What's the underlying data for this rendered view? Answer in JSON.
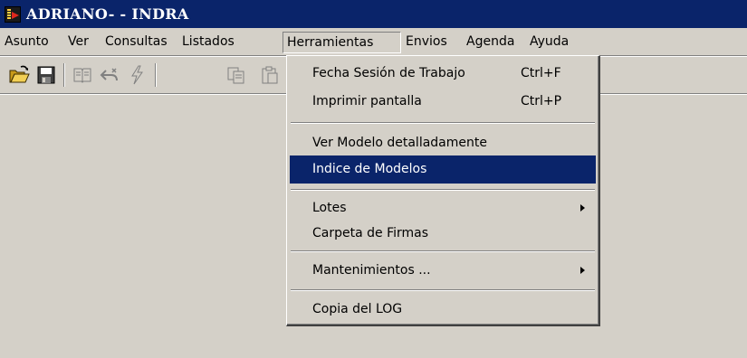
{
  "window": {
    "title": "ADRIANO- - INDRA",
    "app_icon": "app-logo-icon"
  },
  "menubar": {
    "items": [
      {
        "label": "Asunto"
      },
      {
        "label": "Ver"
      },
      {
        "label": "Consultas"
      },
      {
        "label": "Listados"
      },
      {
        "label": "Herramientas",
        "open": true
      },
      {
        "label": "Envios"
      },
      {
        "label": "Agenda"
      },
      {
        "label": "Ayuda"
      }
    ]
  },
  "toolbar": {
    "buttons": [
      {
        "icon": "open-folder-icon",
        "enabled": true
      },
      {
        "icon": "save-icon",
        "enabled": true
      },
      {
        "icon": "book-icon",
        "enabled": false
      },
      {
        "icon": "undo-icon",
        "enabled": false
      },
      {
        "icon": "lightning-icon",
        "enabled": false
      },
      {
        "icon": "copy-icon",
        "enabled": false
      },
      {
        "icon": "paste-icon",
        "enabled": false
      }
    ]
  },
  "dropdown": {
    "menu": "Herramientas",
    "items": [
      {
        "label": "Fecha Sesión de Trabajo",
        "shortcut": "Ctrl+F"
      },
      {
        "label": "Imprimir pantalla",
        "shortcut": "Ctrl+P"
      },
      {
        "label": "Ver Modelo detalladamente"
      },
      {
        "label": "Indice de Modelos",
        "selected": true
      },
      {
        "label": "Lotes",
        "submenu": true
      },
      {
        "label": "Carpeta de Firmas"
      },
      {
        "label": "Mantenimientos ...",
        "submenu": true
      },
      {
        "label": "Copia del LOG"
      }
    ]
  },
  "colors": {
    "titlebar_bg": "#0a246a",
    "face": "#d4d0c8",
    "selection": "#0a246a",
    "selection_text": "#ffffff"
  }
}
